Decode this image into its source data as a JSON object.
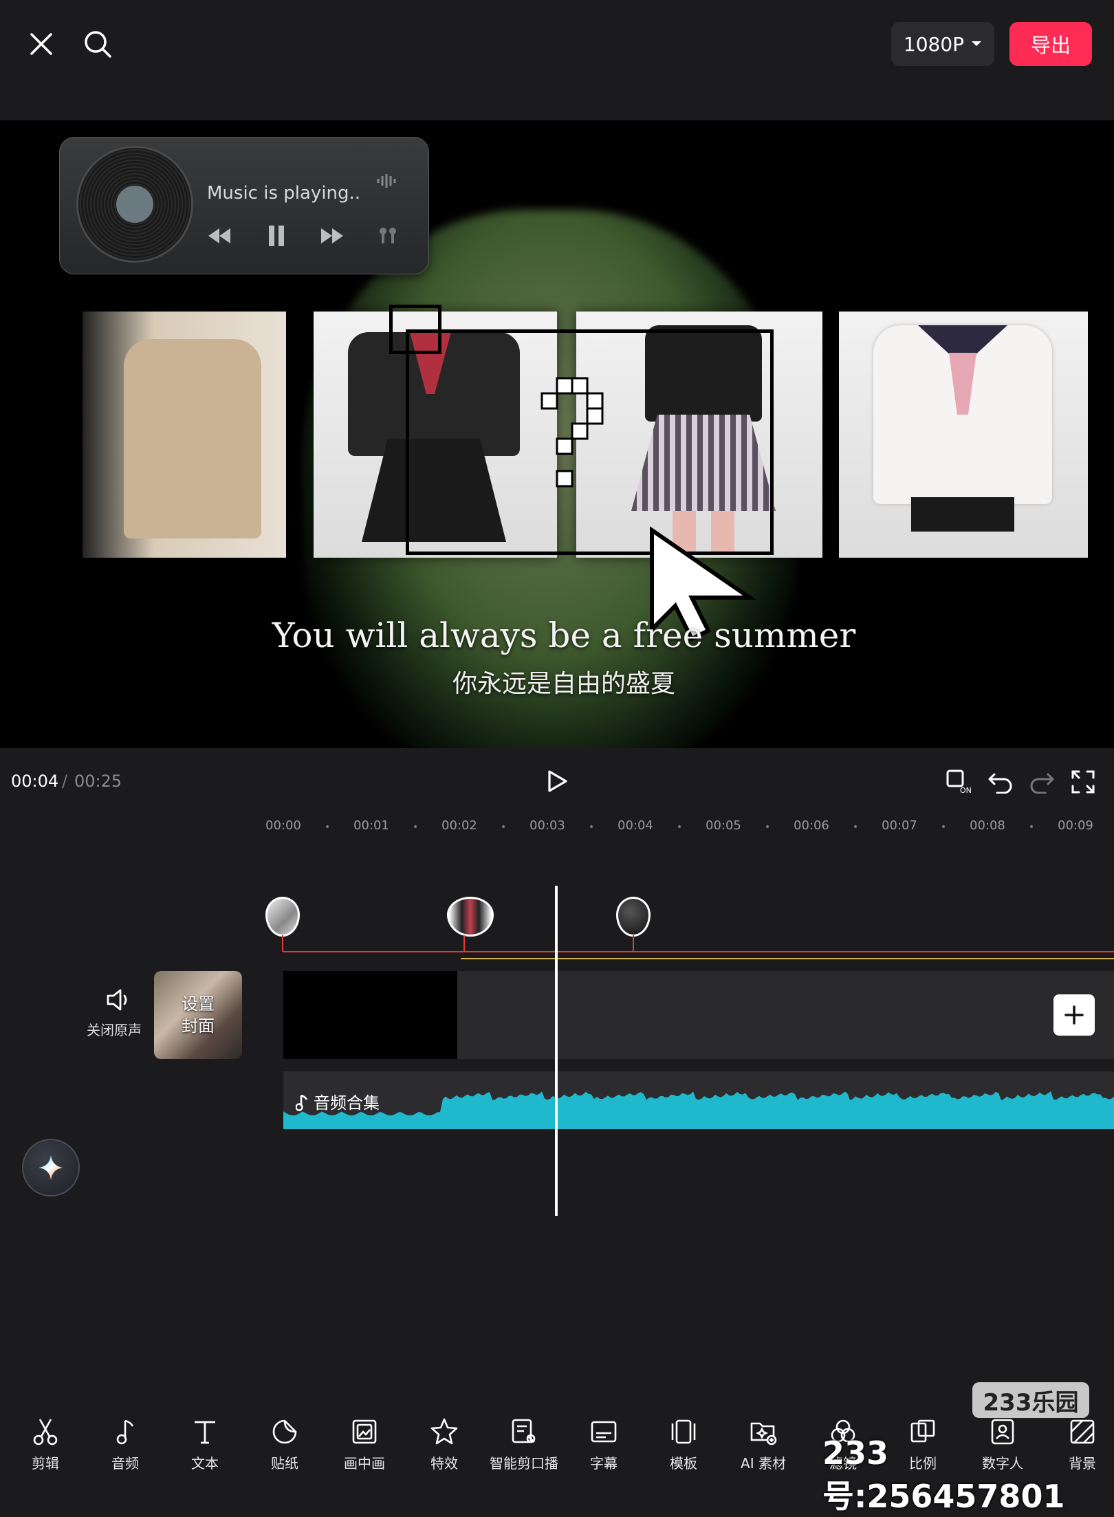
{
  "header": {
    "resolution_label": "1080P",
    "export_label": "导出"
  },
  "preview": {
    "music_widget_text": "Music is playing..",
    "subtitle_en": "You will always be a free summer",
    "subtitle_zh": "你永远是自由的盛夏"
  },
  "playback": {
    "current_time": "00:04",
    "separator": "/",
    "total_time": "00:25"
  },
  "ruler": {
    "ticks": [
      "00:00",
      "00:01",
      "00:02",
      "00:03",
      "00:04",
      "00:05",
      "00:06",
      "00:07",
      "00:08",
      "00:09"
    ]
  },
  "timeline": {
    "mute_label": "关闭原声",
    "cover_line1": "设置",
    "cover_line2": "封面",
    "audio_label": "音频合集"
  },
  "toolbar": {
    "items": [
      {
        "label": "剪辑",
        "icon": "scissors-icon"
      },
      {
        "label": "音频",
        "icon": "music-note-icon"
      },
      {
        "label": "文本",
        "icon": "text-icon"
      },
      {
        "label": "贴纸",
        "icon": "sticker-icon"
      },
      {
        "label": "画中画",
        "icon": "picture-in-picture-icon"
      },
      {
        "label": "特效",
        "icon": "effects-star-icon"
      },
      {
        "label": "智能剪口播",
        "icon": "smart-edit-icon"
      },
      {
        "label": "字幕",
        "icon": "subtitle-icon"
      },
      {
        "label": "模板",
        "icon": "template-icon"
      },
      {
        "label": "AI 素材",
        "icon": "ai-material-icon"
      },
      {
        "label": "滤镜",
        "icon": "filter-icon"
      },
      {
        "label": "比例",
        "icon": "ratio-icon"
      },
      {
        "label": "数字人",
        "icon": "digital-human-icon"
      },
      {
        "label": "背景",
        "icon": "background-icon"
      }
    ]
  },
  "watermark": {
    "logo": "233乐园",
    "text": "233号:256457801"
  },
  "colors": {
    "accent": "#fe2c55",
    "background": "#1b1b1d",
    "audio_wave": "#1fb8cc",
    "marker_line": "#e03a3a"
  }
}
